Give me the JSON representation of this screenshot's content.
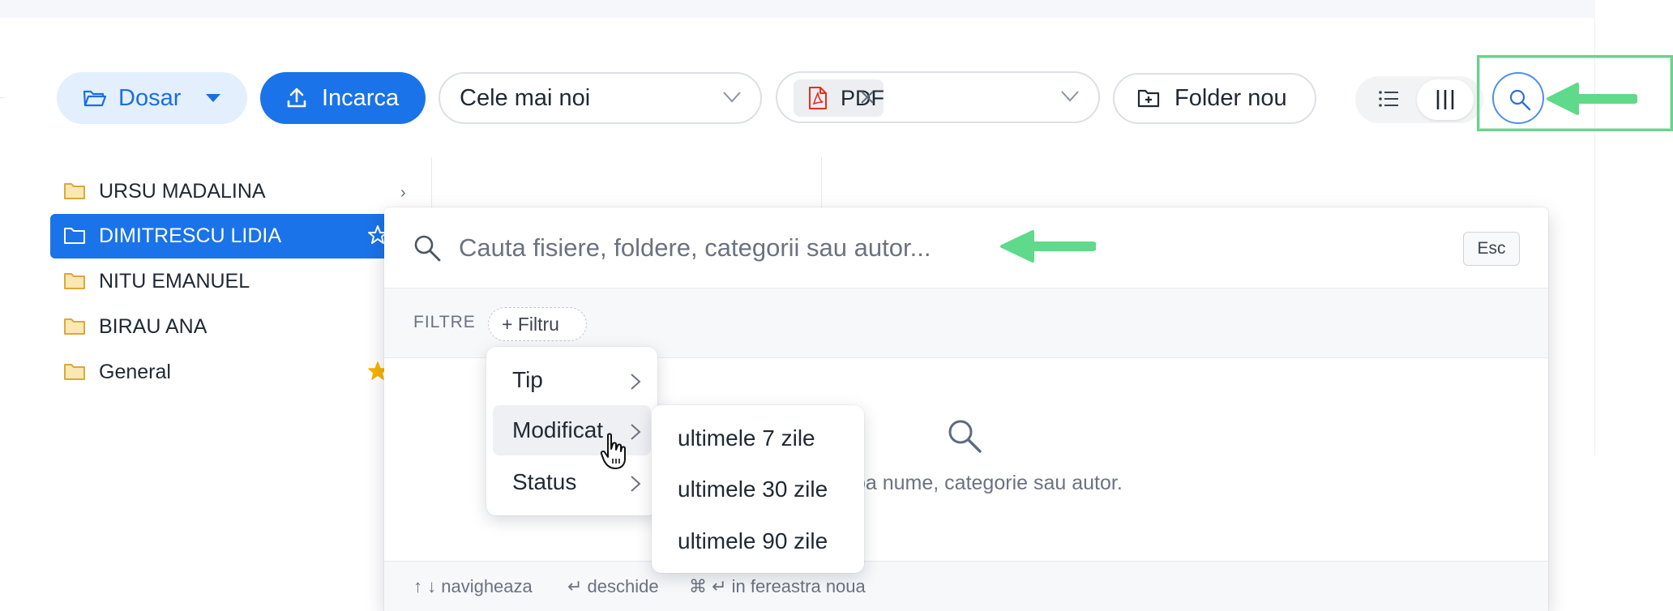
{
  "toolbar": {
    "dosar_label": "Dosar",
    "upload_label": "Incarca",
    "sort_value": "Cele mai noi",
    "type_filter_chip": "PDF",
    "new_folder_label": "Folder nou"
  },
  "sidebar": {
    "items": [
      {
        "label": "URSU MADALINA",
        "active": false,
        "starred": false
      },
      {
        "label": "DIMITRESCU LIDIA",
        "active": true,
        "starred": false
      },
      {
        "label": "NITU EMANUEL",
        "active": false,
        "starred": false
      },
      {
        "label": "BIRAU ANA",
        "active": false,
        "starred": false
      },
      {
        "label": "General",
        "active": false,
        "starred": true
      }
    ],
    "expander": "›"
  },
  "search": {
    "placeholder": "Cauta fisiere, foldere, categorii sau autor...",
    "esc_label": "Esc",
    "filters_label": "FILTRE",
    "add_filter_label": "+ Filtru",
    "empty_text": "pa nume, categorie sau autor."
  },
  "filter_menu": {
    "items": [
      "Tip",
      "Modificat",
      "Status"
    ],
    "hovered": "Modificat",
    "submenu": [
      "ultimele 7 zile",
      "ultimele 30 zile",
      "ultimele 90 zile"
    ]
  },
  "footer": {
    "hints": [
      "↑ ↓ navigheaza",
      "↵ deschide",
      "⌘ ↵ in fereastra noua"
    ]
  },
  "colors": {
    "accent": "#1a73e8",
    "highlight_box": "#6bd28f",
    "arrow": "#5fd98a",
    "star": "#f5b400",
    "pdf": "#e0301e",
    "folder": "#e8c46a"
  },
  "icons": {
    "dosar": "folder-open-icon",
    "upload": "upload-icon",
    "new_folder": "folder-plus-icon",
    "view_list": "list-icon",
    "view_columns": "columns-icon",
    "search": "search-icon"
  }
}
